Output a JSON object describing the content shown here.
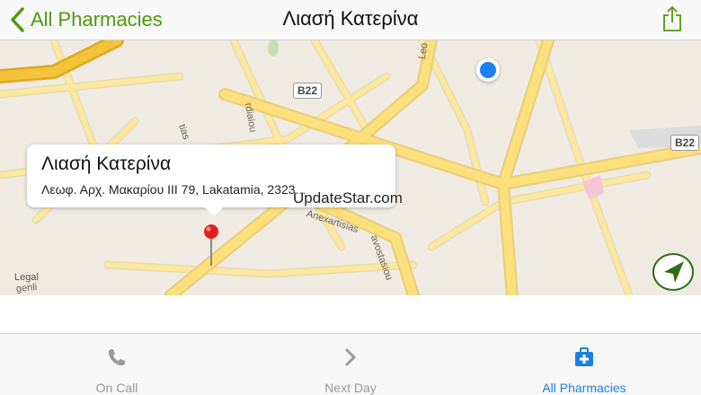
{
  "nav": {
    "back_label": "All Pharmacies",
    "title": "Λιασή Κατερίνα"
  },
  "map": {
    "road_labels": [
      "Anexartisias",
      "avostasiou",
      "tias",
      "rdiaiou",
      "Leo",
      "genli"
    ],
    "route_shields": [
      "B22",
      "B22"
    ],
    "legal": "Legal",
    "watermark": "UpdateStar.com"
  },
  "callout": {
    "title": "Λιασή Κατερίνα",
    "address": "Λεωφ. Αρχ. Μακαρίου ΙΙΙ 79, Lakatamia, 2323..."
  },
  "tabs": [
    {
      "label": "On Call",
      "icon": "phone-icon",
      "active": false
    },
    {
      "label": "Next Day",
      "icon": "chevron-right-icon",
      "active": false
    },
    {
      "label": "All Pharmacies",
      "icon": "medical-kit-icon",
      "active": true
    }
  ],
  "colors": {
    "accent_green": "#4e9a0c",
    "tab_active": "#1f7fe0",
    "user_location": "#1a7ef2",
    "pin": "#e02020",
    "road_fill": "#fbe9a0",
    "highway": "#f5c33b"
  }
}
